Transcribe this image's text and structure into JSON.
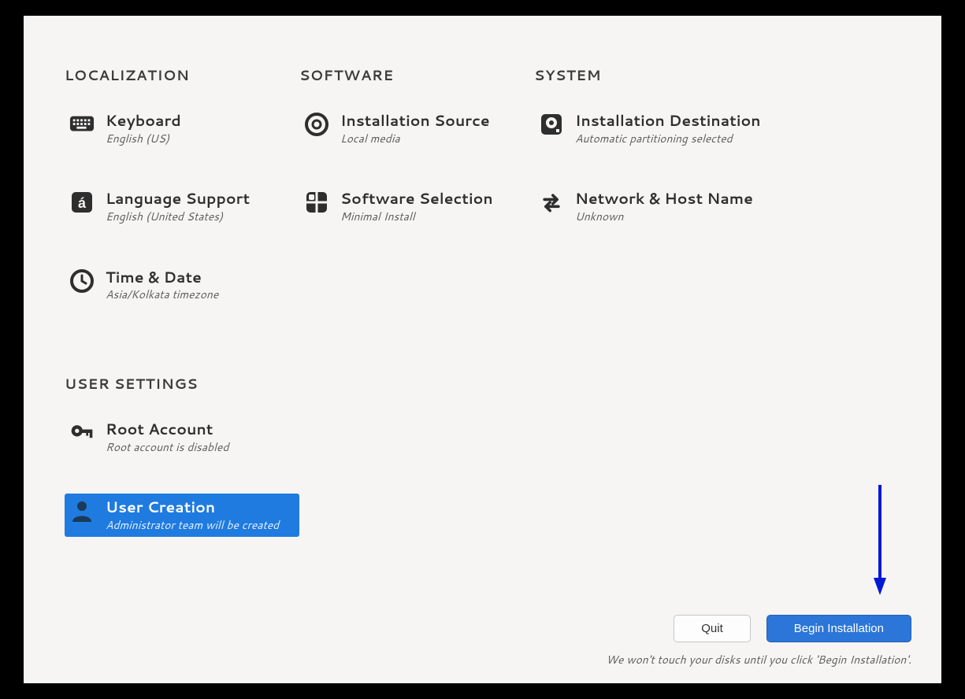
{
  "sections": {
    "localization": "LOCALIZATION",
    "software": "SOFTWARE",
    "system": "SYSTEM",
    "user": "USER SETTINGS"
  },
  "spokes": {
    "keyboard": {
      "title": "Keyboard",
      "status": "English (US)"
    },
    "language": {
      "title": "Language Support",
      "status": "English (United States)"
    },
    "datetime": {
      "title": "Time & Date",
      "status": "Asia/Kolkata timezone"
    },
    "source": {
      "title": "Installation Source",
      "status": "Local media"
    },
    "software": {
      "title": "Software Selection",
      "status": "Minimal Install"
    },
    "destination": {
      "title": "Installation Destination",
      "status": "Automatic partitioning selected"
    },
    "network": {
      "title": "Network & Host Name",
      "status": "Unknown"
    },
    "root": {
      "title": "Root Account",
      "status": "Root account is disabled"
    },
    "user": {
      "title": "User Creation",
      "status": "Administrator team will be created"
    }
  },
  "footer": {
    "quit": "Quit",
    "begin": "Begin Installation",
    "hint": "We won't touch your disks until you click 'Begin Installation'."
  }
}
